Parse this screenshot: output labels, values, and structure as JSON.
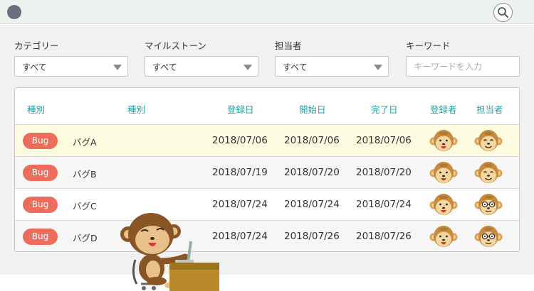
{
  "filters": {
    "category": {
      "label": "カテゴリー",
      "value": "すべて"
    },
    "milestone": {
      "label": "マイルストーン",
      "value": "すべて"
    },
    "assignee": {
      "label": "担当者",
      "value": "すべて"
    },
    "keyword": {
      "label": "キーワード",
      "placeholder": "キーワードを入力",
      "value": ""
    }
  },
  "table": {
    "columns": [
      "種別",
      "種別",
      "登録日",
      "開始日",
      "完了日",
      "登録者",
      "担当者"
    ],
    "rows": [
      {
        "type": "Bug",
        "name": "バグA",
        "registered": "2018/07/06",
        "start": "2018/07/06",
        "done": "2018/07/06",
        "assignee_icon": "monkey-smile-icon"
      },
      {
        "type": "Bug",
        "name": "バグB",
        "registered": "2018/07/19",
        "start": "2018/07/20",
        "done": "2018/07/20",
        "assignee_icon": "monkey-smile-icon"
      },
      {
        "type": "Bug",
        "name": "バグC",
        "registered": "2018/07/24",
        "start": "2018/07/24",
        "done": "2018/07/24",
        "assignee_icon": "monkey-glasses-icon"
      },
      {
        "type": "Bug",
        "name": "バグD",
        "registered": "2018/07/24",
        "start": "2018/07/26",
        "done": "2018/07/26",
        "assignee_icon": "monkey-glasses-icon"
      }
    ]
  },
  "colors": {
    "accent": "#20a2a0",
    "badge": "#ed6c5c",
    "highlight_row": "#fdfbe0",
    "topbar": "#eef2ee"
  },
  "icons": {
    "app": "status-dot-icon",
    "search": "search-icon",
    "reporter": "monkey-face-icon",
    "mascot": "monkey-at-desk-icon"
  }
}
